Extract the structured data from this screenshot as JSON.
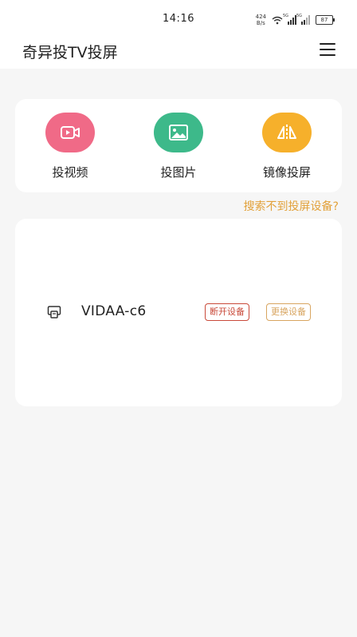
{
  "status_bar": {
    "time": "14:16",
    "net_speed_value": "424",
    "net_speed_unit": "B/s",
    "signal_tag": "5G",
    "battery": "87"
  },
  "app_bar": {
    "title": "奇异投TV投屏",
    "menu_icon": "hamburger-menu-icon"
  },
  "actions": [
    {
      "label": "投视频",
      "icon": "video-camera-icon",
      "color": "#f06a87"
    },
    {
      "label": "投图片",
      "icon": "image-icon",
      "color": "#3db98a"
    },
    {
      "label": "镜像投屏",
      "icon": "mirror-icon",
      "color": "#f6b02b"
    }
  ],
  "help_link": "搜索不到投屏设备?",
  "device": {
    "icon": "cast-screen-icon",
    "name": "VIDAA-c6",
    "disconnect_label": "断开设备",
    "change_label": "更换设备"
  }
}
